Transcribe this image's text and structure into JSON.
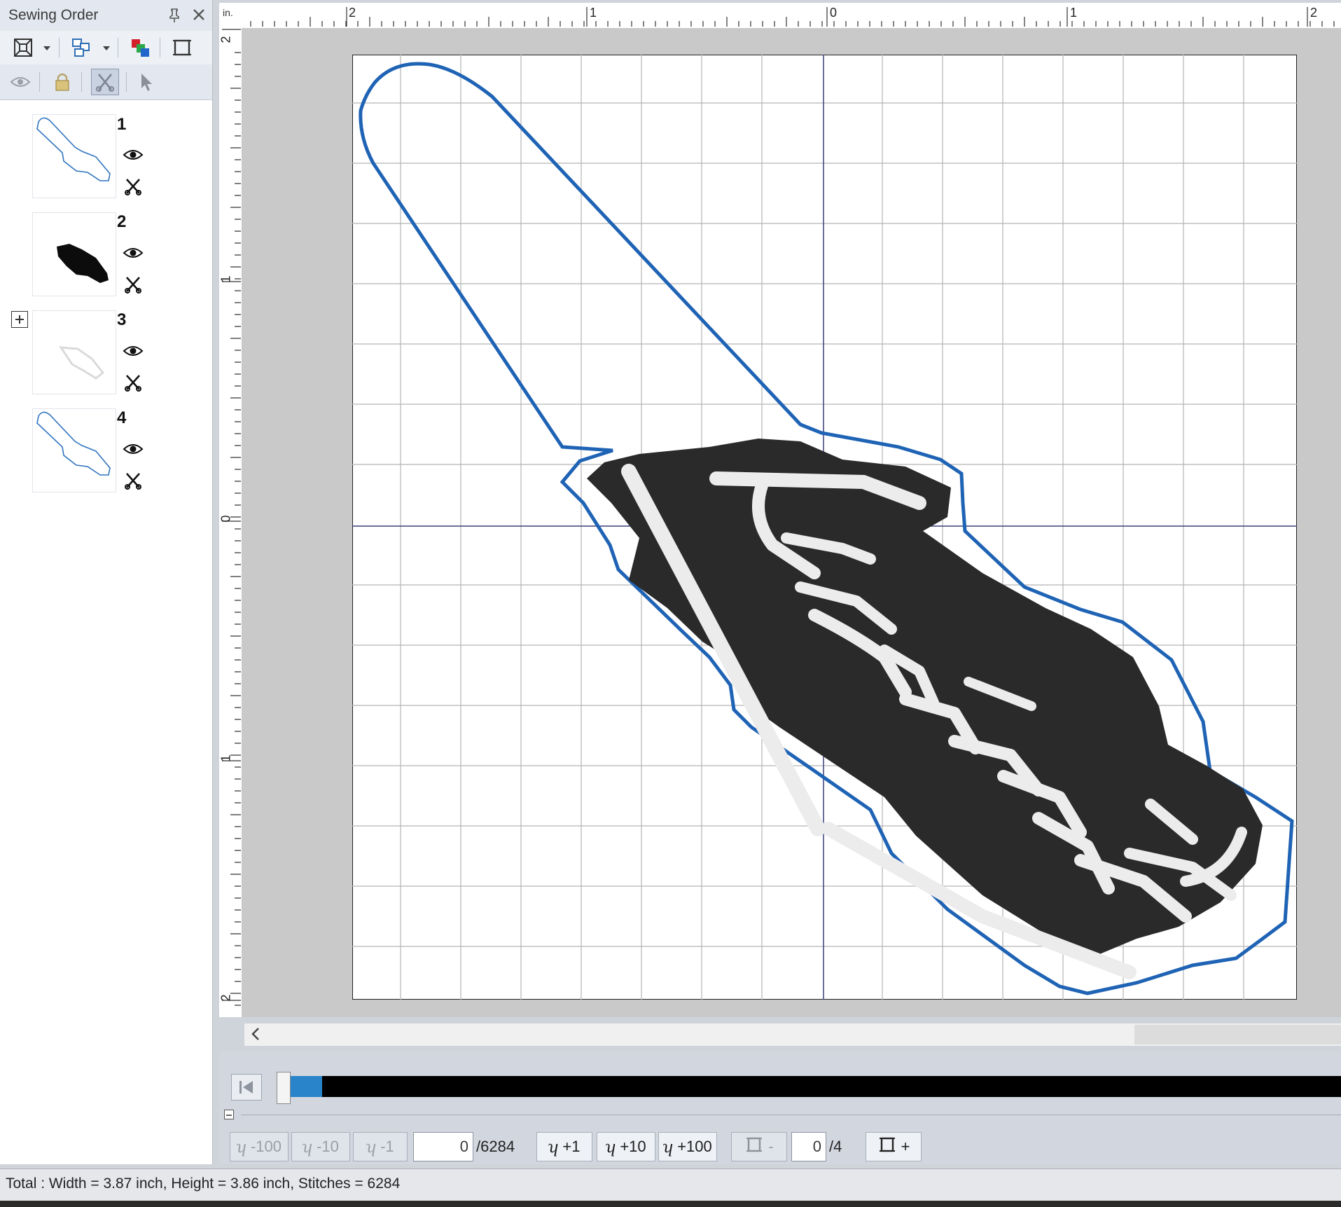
{
  "panel": {
    "title": "Sewing Order",
    "pin_icon": "pin-icon",
    "close_icon": "close-icon"
  },
  "layers": [
    {
      "number": "1",
      "thumb": "outline"
    },
    {
      "number": "2",
      "thumb": "filled-black"
    },
    {
      "number": "3",
      "thumb": "light-text"
    },
    {
      "number": "4",
      "thumb": "outline"
    }
  ],
  "ruler": {
    "units": "in.",
    "top_labels": [
      "2",
      "1",
      "0",
      "1",
      "2"
    ],
    "left_labels": [
      "2",
      "1",
      "0",
      "1",
      "2"
    ]
  },
  "controls": {
    "minus100": "-100",
    "minus10": "-10",
    "minus1": "-1",
    "stitch_value": "0",
    "stitch_total": "/6284",
    "plus1": "+1",
    "plus10": "+10",
    "plus100": "+100",
    "color_minus": "-",
    "color_value": "0",
    "color_total": "/4",
    "color_plus": "+",
    "progress_fraction": 0.0
  },
  "status": {
    "text": "Total : Width = 3.87 inch, Height = 3.86 inch, Stitches = 6284"
  },
  "colors": {
    "outline_blue": "#1f63b5",
    "fill_dark": "#2a2a2a",
    "text_white": "#ececec",
    "progress_blue": "#2a84c9"
  }
}
